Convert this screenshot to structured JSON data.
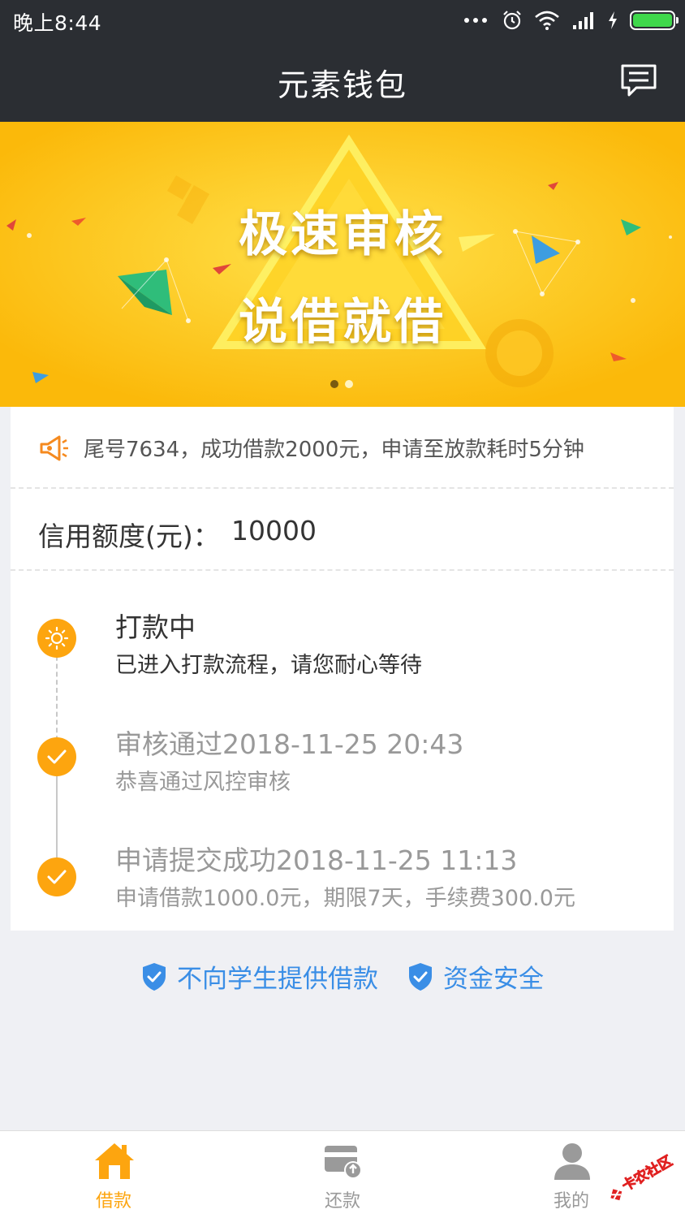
{
  "status_bar": {
    "time": "晚上8:44",
    "icons": [
      "more-dots-icon",
      "alarm-icon",
      "wifi-icon",
      "signal-icon",
      "charging-icon",
      "battery-icon"
    ],
    "battery_color": "#3fd84b"
  },
  "header": {
    "title": "元素钱包",
    "message_icon": "message-icon"
  },
  "banner": {
    "line1": "极速审核",
    "line2": "说借就借",
    "bg_color": "#fdc415",
    "pager": {
      "count": 2,
      "active_index": 0
    }
  },
  "notice": {
    "icon": "speaker-icon",
    "text": "尾号7634，成功借款2000元，申请至放款耗时5分钟"
  },
  "credit": {
    "label": "信用额度(元)：",
    "value": "10000"
  },
  "timeline": [
    {
      "status": "active",
      "icon": "sun-icon",
      "title": "打款中",
      "desc": "已进入打款流程，请您耐心等待"
    },
    {
      "status": "done",
      "icon": "check-icon",
      "title": "审核通过2018-11-25 20:43",
      "desc": "恭喜通过风控审核"
    },
    {
      "status": "done",
      "icon": "check-icon",
      "title": "申请提交成功2018-11-25 11:13",
      "desc": "申请借款1000.0元，期限7天，手续费300.0元"
    }
  ],
  "assurances": [
    {
      "icon": "shield-check-icon",
      "text": "不向学生提供借款"
    },
    {
      "icon": "shield-check-icon",
      "text": "资金安全"
    }
  ],
  "tabs": [
    {
      "icon": "home-icon",
      "label": "借款",
      "active": true
    },
    {
      "icon": "repay-card-icon",
      "label": "还款",
      "active": false
    },
    {
      "icon": "user-icon",
      "label": "我的",
      "active": false
    }
  ],
  "watermark": {
    "text": "卡农社区"
  },
  "colors": {
    "accent": "#fda50f",
    "header_bg": "#2b2e33",
    "assurance_blue": "#3a8ee6",
    "tab_inactive": "#999999"
  }
}
